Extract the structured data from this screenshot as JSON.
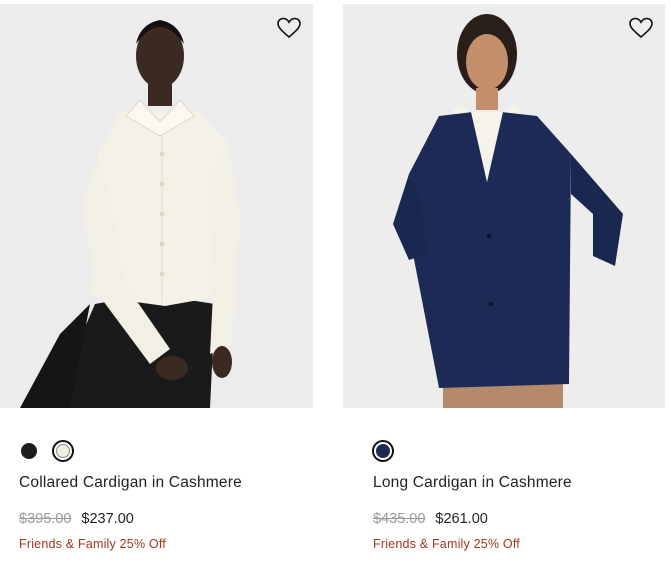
{
  "products": [
    {
      "name": "Collared Cardigan in Cashmere",
      "image_alt": "Model wearing ivory collared cashmere cardigan with black trousers",
      "wishlist_icon": "heart-outline-icon",
      "swatches": [
        {
          "color_name": "Black",
          "hex": "#1c1c1c",
          "selected": false
        },
        {
          "color_name": "Ivory",
          "hex": "#efeee4",
          "selected": true
        }
      ],
      "original_price": "$395.00",
      "sale_price": "$237.00",
      "promo": "Friends & Family 25% Off"
    },
    {
      "name": "Long Cardigan in Cashmere",
      "image_alt": "Model wearing long navy cashmere cardigan over ivory shirt",
      "wishlist_icon": "heart-outline-icon",
      "swatches": [
        {
          "color_name": "Navy",
          "hex": "#1e2a52",
          "selected": true
        }
      ],
      "original_price": "$435.00",
      "sale_price": "$261.00",
      "promo": "Friends & Family 25% Off"
    }
  ],
  "colors": {
    "promo_red": "#a4341f",
    "strike_gray": "#9a9a9a",
    "photo_bg": "#ececec"
  }
}
